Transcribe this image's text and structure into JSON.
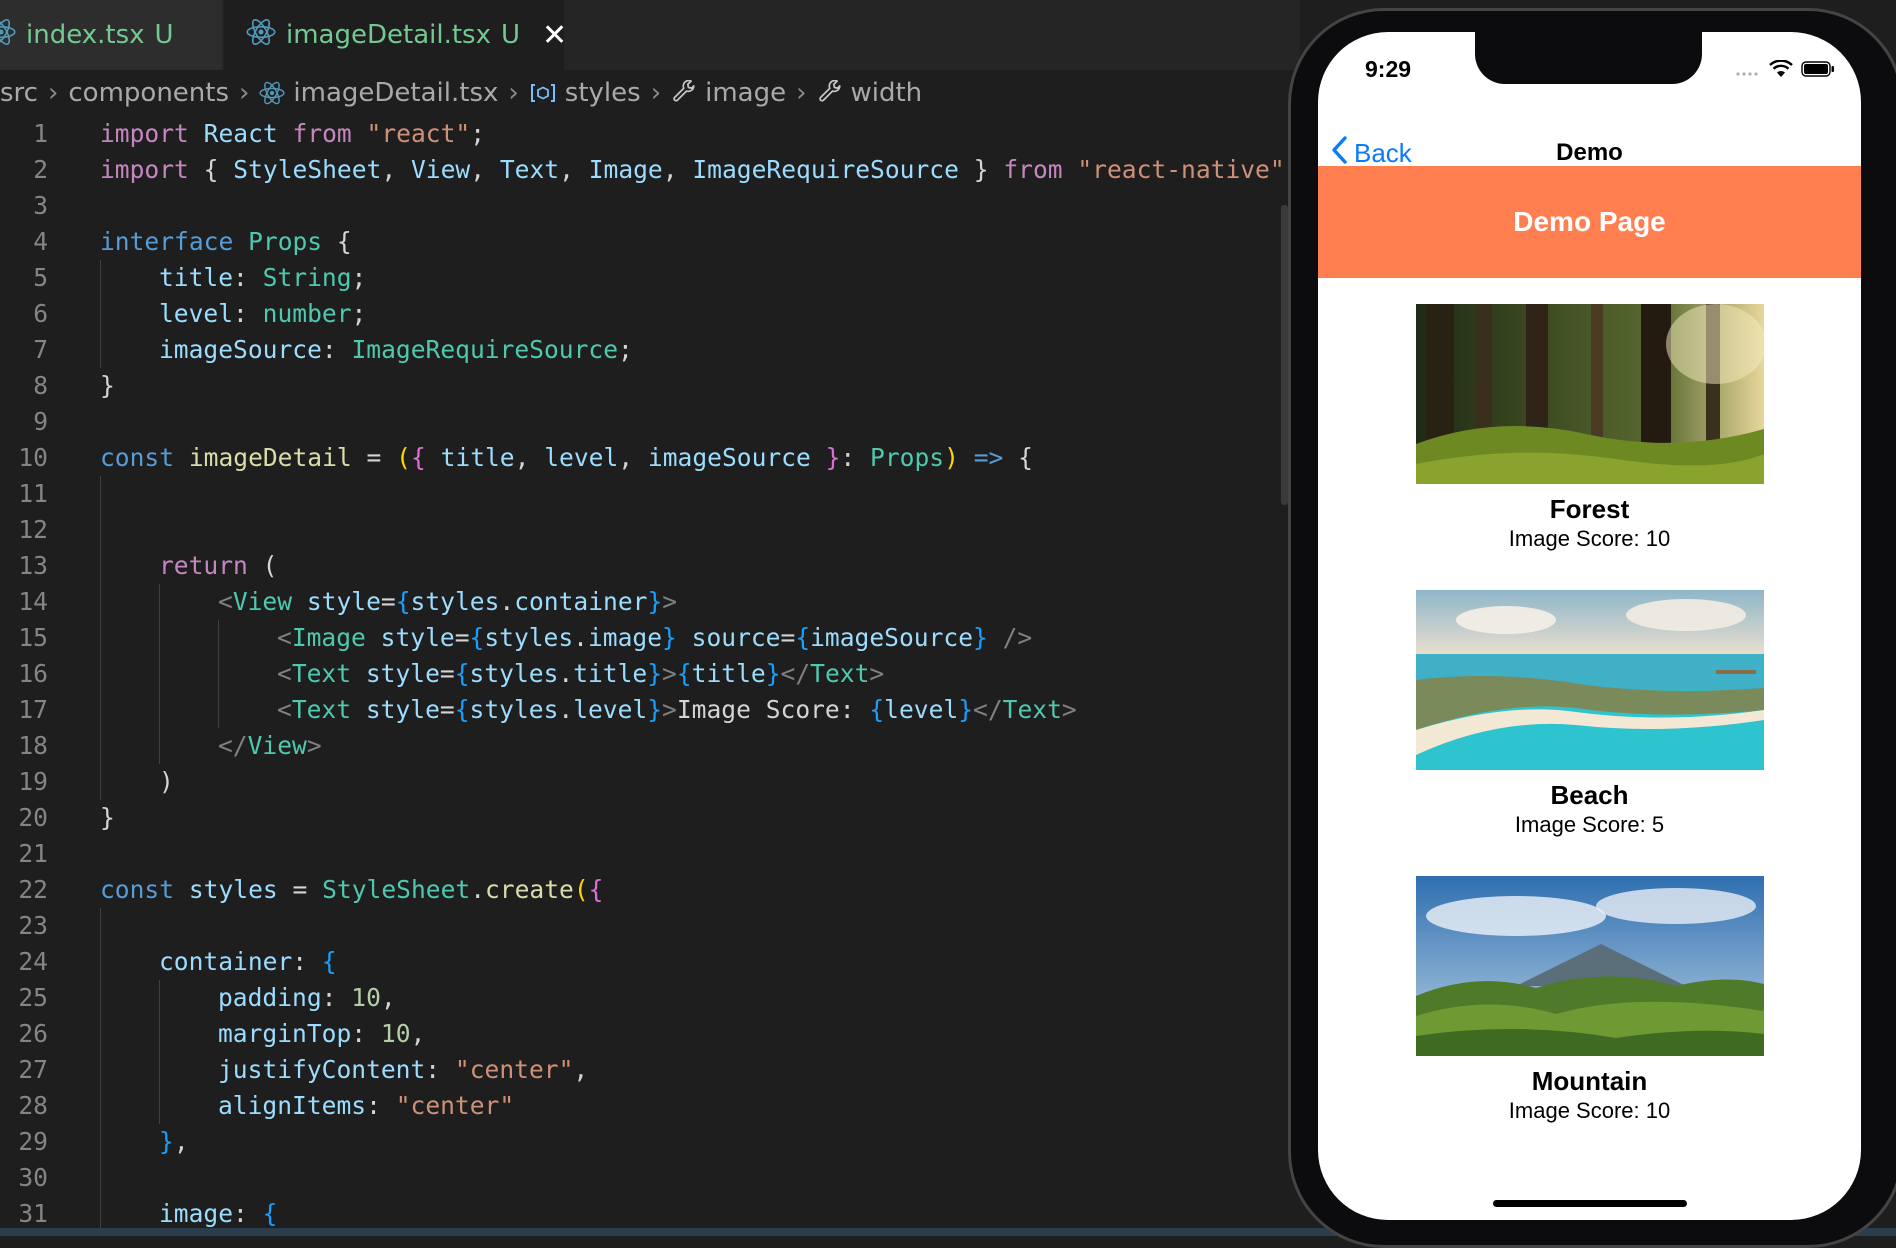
{
  "editor": {
    "tabs": [
      {
        "name": "index.tsx",
        "status": "U",
        "active": false
      },
      {
        "name": "imageDetail.tsx",
        "status": "U",
        "active": true,
        "close": "✕"
      }
    ],
    "breadcrumb": [
      "src",
      "components",
      "imageDetail.tsx",
      "styles",
      "image",
      "width"
    ],
    "code_lines": [
      {
        "n": "1",
        "indent": 0,
        "t": [
          [
            "kw",
            "import "
          ],
          [
            "var",
            "React"
          ],
          [
            "kw",
            " from "
          ],
          [
            "str",
            "\"react\""
          ],
          [
            "pl",
            ";"
          ]
        ]
      },
      {
        "n": "2",
        "indent": 0,
        "t": [
          [
            "kw",
            "import "
          ],
          [
            "pl",
            "{ "
          ],
          [
            "var",
            "StyleSheet"
          ],
          [
            "pl",
            ", "
          ],
          [
            "var",
            "View"
          ],
          [
            "pl",
            ", "
          ],
          [
            "var",
            "Text"
          ],
          [
            "pl",
            ", "
          ],
          [
            "var",
            "Image"
          ],
          [
            "pl",
            ", "
          ],
          [
            "var",
            "ImageRequireSource"
          ],
          [
            "pl",
            " } "
          ],
          [
            "kw",
            "from "
          ],
          [
            "str",
            "\"react-native\""
          ],
          [
            "pl",
            ";"
          ]
        ]
      },
      {
        "n": "3",
        "indent": 0,
        "t": []
      },
      {
        "n": "4",
        "indent": 0,
        "t": [
          [
            "st",
            "interface "
          ],
          [
            "ty",
            "Props "
          ],
          [
            "pl",
            "{"
          ]
        ]
      },
      {
        "n": "5",
        "indent": 1,
        "t": [
          [
            "var",
            "title"
          ],
          [
            "pl",
            ": "
          ],
          [
            "ty",
            "String"
          ],
          [
            "pl",
            ";"
          ]
        ]
      },
      {
        "n": "6",
        "indent": 1,
        "t": [
          [
            "var",
            "level"
          ],
          [
            "pl",
            ": "
          ],
          [
            "ty",
            "number"
          ],
          [
            "pl",
            ";"
          ]
        ]
      },
      {
        "n": "7",
        "indent": 1,
        "t": [
          [
            "var",
            "imageSource"
          ],
          [
            "pl",
            ": "
          ],
          [
            "ty",
            "ImageRequireSource"
          ],
          [
            "pl",
            ";"
          ]
        ]
      },
      {
        "n": "8",
        "indent": 0,
        "t": [
          [
            "pl",
            "}"
          ]
        ]
      },
      {
        "n": "9",
        "indent": 0,
        "t": []
      },
      {
        "n": "10",
        "indent": 0,
        "t": [
          [
            "st",
            "const "
          ],
          [
            "fn",
            "imageDetail"
          ],
          [
            "pl",
            " = "
          ],
          [
            "br1",
            "("
          ],
          [
            "br2",
            "{ "
          ],
          [
            "var",
            "title"
          ],
          [
            "pl",
            ", "
          ],
          [
            "var",
            "level"
          ],
          [
            "pl",
            ", "
          ],
          [
            "var",
            "imageSource"
          ],
          [
            "br2",
            " }"
          ],
          [
            "pl",
            ": "
          ],
          [
            "ty",
            "Props"
          ],
          [
            "br1",
            ")"
          ],
          [
            "st",
            " => "
          ],
          [
            "pl",
            "{"
          ]
        ]
      },
      {
        "n": "11",
        "indent": 1,
        "t": []
      },
      {
        "n": "12",
        "indent": 1,
        "t": []
      },
      {
        "n": "13",
        "indent": 1,
        "t": [
          [
            "kw",
            "return "
          ],
          [
            "pl",
            "("
          ]
        ]
      },
      {
        "n": "14",
        "indent": 2,
        "t": [
          [
            "tag",
            "<"
          ],
          [
            "ty",
            "View "
          ],
          [
            "var",
            "style"
          ],
          [
            "pl",
            "="
          ],
          [
            "br3",
            "{"
          ],
          [
            "var",
            "styles"
          ],
          [
            "pl",
            "."
          ],
          [
            "var",
            "container"
          ],
          [
            "br3",
            "}"
          ],
          [
            "tag",
            ">"
          ]
        ]
      },
      {
        "n": "15",
        "indent": 3,
        "t": [
          [
            "tag",
            "<"
          ],
          [
            "ty",
            "Image "
          ],
          [
            "var",
            "style"
          ],
          [
            "pl",
            "="
          ],
          [
            "br3",
            "{"
          ],
          [
            "var",
            "styles"
          ],
          [
            "pl",
            "."
          ],
          [
            "var",
            "image"
          ],
          [
            "br3",
            "}"
          ],
          [
            "var",
            " source"
          ],
          [
            "pl",
            "="
          ],
          [
            "br3",
            "{"
          ],
          [
            "var",
            "imageSource"
          ],
          [
            "br3",
            "}"
          ],
          [
            "tag",
            " />"
          ]
        ]
      },
      {
        "n": "16",
        "indent": 3,
        "t": [
          [
            "tag",
            "<"
          ],
          [
            "ty",
            "Text "
          ],
          [
            "var",
            "style"
          ],
          [
            "pl",
            "="
          ],
          [
            "br3",
            "{"
          ],
          [
            "var",
            "styles"
          ],
          [
            "pl",
            "."
          ],
          [
            "var",
            "title"
          ],
          [
            "br3",
            "}"
          ],
          [
            "tag",
            ">"
          ],
          [
            "br3",
            "{"
          ],
          [
            "var",
            "title"
          ],
          [
            "br3",
            "}"
          ],
          [
            "tag",
            "</"
          ],
          [
            "ty",
            "Text"
          ],
          [
            "tag",
            ">"
          ]
        ]
      },
      {
        "n": "17",
        "indent": 3,
        "t": [
          [
            "tag",
            "<"
          ],
          [
            "ty",
            "Text "
          ],
          [
            "var",
            "style"
          ],
          [
            "pl",
            "="
          ],
          [
            "br3",
            "{"
          ],
          [
            "var",
            "styles"
          ],
          [
            "pl",
            "."
          ],
          [
            "var",
            "level"
          ],
          [
            "br3",
            "}"
          ],
          [
            "tag",
            ">"
          ],
          [
            "pl",
            "Image Score: "
          ],
          [
            "br3",
            "{"
          ],
          [
            "var",
            "level"
          ],
          [
            "br3",
            "}"
          ],
          [
            "tag",
            "</"
          ],
          [
            "ty",
            "Text"
          ],
          [
            "tag",
            ">"
          ]
        ]
      },
      {
        "n": "18",
        "indent": 2,
        "t": [
          [
            "tag",
            "</"
          ],
          [
            "ty",
            "View"
          ],
          [
            "tag",
            ">"
          ]
        ]
      },
      {
        "n": "19",
        "indent": 1,
        "t": [
          [
            "pl",
            ")"
          ]
        ]
      },
      {
        "n": "20",
        "indent": 0,
        "t": [
          [
            "pl",
            "}"
          ]
        ]
      },
      {
        "n": "21",
        "indent": 0,
        "t": []
      },
      {
        "n": "22",
        "indent": 0,
        "t": [
          [
            "st",
            "const "
          ],
          [
            "var",
            "styles"
          ],
          [
            "pl",
            " = "
          ],
          [
            "ty",
            "StyleSheet"
          ],
          [
            "pl",
            "."
          ],
          [
            "fn",
            "create"
          ],
          [
            "br1",
            "("
          ],
          [
            "br2",
            "{"
          ]
        ]
      },
      {
        "n": "23",
        "indent": 1,
        "t": []
      },
      {
        "n": "24",
        "indent": 1,
        "t": [
          [
            "var",
            "container"
          ],
          [
            "pl",
            ": "
          ],
          [
            "br3",
            "{"
          ]
        ]
      },
      {
        "n": "25",
        "indent": 2,
        "t": [
          [
            "var",
            "padding"
          ],
          [
            "pl",
            ": "
          ],
          [
            "num",
            "10"
          ],
          [
            "pl",
            ","
          ]
        ]
      },
      {
        "n": "26",
        "indent": 2,
        "t": [
          [
            "var",
            "marginTop"
          ],
          [
            "pl",
            ": "
          ],
          [
            "num",
            "10"
          ],
          [
            "pl",
            ","
          ]
        ]
      },
      {
        "n": "27",
        "indent": 2,
        "t": [
          [
            "var",
            "justifyContent"
          ],
          [
            "pl",
            ": "
          ],
          [
            "str",
            "\"center\""
          ],
          [
            "pl",
            ","
          ]
        ]
      },
      {
        "n": "28",
        "indent": 2,
        "t": [
          [
            "var",
            "alignItems"
          ],
          [
            "pl",
            ": "
          ],
          [
            "str",
            "\"center\""
          ]
        ]
      },
      {
        "n": "29",
        "indent": 1,
        "t": [
          [
            "br3",
            "}"
          ],
          [
            "pl",
            ","
          ]
        ]
      },
      {
        "n": "30",
        "indent": 1,
        "t": []
      },
      {
        "n": "31",
        "indent": 1,
        "t": [
          [
            "var",
            "image"
          ],
          [
            "pl",
            ": "
          ],
          [
            "br3",
            "{"
          ]
        ]
      }
    ]
  },
  "phone": {
    "time": "9:29",
    "nav": {
      "back": "Back",
      "title": "Demo"
    },
    "banner": "Demo Page",
    "cards": [
      {
        "title": "Forest",
        "score": "Image Score: 10",
        "scene": "forest"
      },
      {
        "title": "Beach",
        "score": "Image Score: 5",
        "scene": "beach"
      },
      {
        "title": "Mountain",
        "score": "Image Score: 10",
        "scene": "mountain"
      }
    ],
    "colors": {
      "banner": "#ff7f50",
      "back": "#0a7aff"
    }
  }
}
